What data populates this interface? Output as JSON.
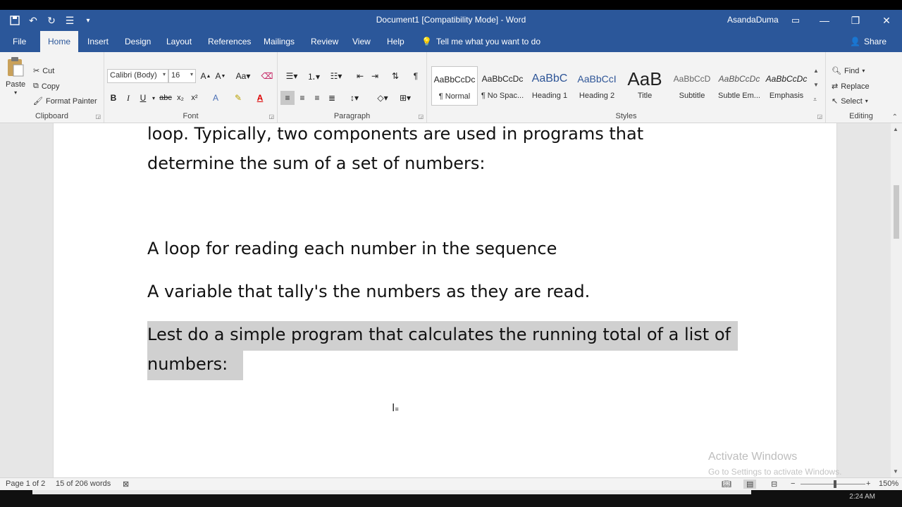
{
  "window": {
    "title": "Document1 [Compatibility Mode]  -  Word",
    "user": "AsandaDuma"
  },
  "tabs": [
    {
      "label": "File"
    },
    {
      "label": "Home"
    },
    {
      "label": "Insert"
    },
    {
      "label": "Design"
    },
    {
      "label": "Layout"
    },
    {
      "label": "References"
    },
    {
      "label": "Mailings"
    },
    {
      "label": "Review"
    },
    {
      "label": "View"
    },
    {
      "label": "Help"
    }
  ],
  "tell_me": "Tell me what you want to do",
  "share": "Share",
  "clipboard": {
    "paste": "Paste",
    "cut": "Cut",
    "copy": "Copy",
    "format_painter": "Format Painter",
    "label": "Clipboard"
  },
  "font": {
    "name": "Calibri (Body)",
    "size": "16",
    "label": "Font"
  },
  "paragraph": {
    "label": "Paragraph"
  },
  "styles": {
    "label": "Styles",
    "items": [
      {
        "preview": "AaBbCcDc",
        "name": "¶ Normal"
      },
      {
        "preview": "AaBbCcDc",
        "name": "¶ No Spac..."
      },
      {
        "preview": "AaBbC",
        "name": "Heading 1"
      },
      {
        "preview": "AaBbCcI",
        "name": "Heading 2"
      },
      {
        "preview": "AaB",
        "name": "Title"
      },
      {
        "preview": "AaBbCcD",
        "name": "Subtitle"
      },
      {
        "preview": "AaBbCcDc",
        "name": "Subtle Em..."
      },
      {
        "preview": "AaBbCcDc",
        "name": "Emphasis"
      }
    ]
  },
  "editing": {
    "find": "Find",
    "replace": "Replace",
    "select": "Select",
    "label": "Editing"
  },
  "document": {
    "lines": [
      "loop. Typically, two components are used in programs that",
      "determine the sum of a set of numbers:",
      "A loop for reading each number in the sequence",
      "A variable that tally's the numbers as they are read.",
      "Lest do a simple program that calculates the running total of a list of",
      "numbers: "
    ]
  },
  "watermark": {
    "title": "Activate Windows",
    "subtitle": "Go to Settings to activate Windows."
  },
  "status": {
    "page": "Page 1 of 2",
    "words": "15 of 206 words",
    "zoom": "150%"
  },
  "taskbar": {
    "clock": "2:24 AM"
  }
}
